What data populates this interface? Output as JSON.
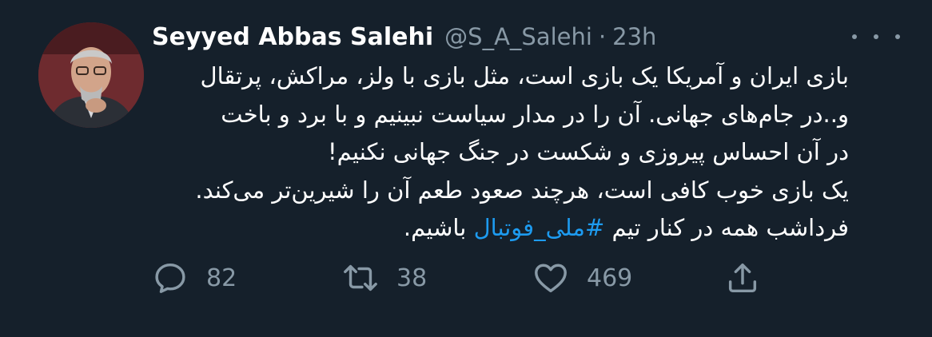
{
  "tweet": {
    "author_name": "Seyyed Abbas Salehi",
    "handle": "@S_A_Salehi",
    "separator": "·",
    "time": "23h",
    "body_lines": [
      "بازی ایران و آمریکا یک بازی است، مثل بازی با ولز، مراکش، پرتقال",
      "و..در جام‌های جهانی. آن را در مدار سیاست نبینیم و با برد و باخت",
      "در آن احساس پیروزی و شکست در جنگ جهانی نکنیم!",
      "یک بازی خوب کافی است، هرچند صعود طعم آن را شیرین‌تر می‌کند."
    ],
    "last_line": {
      "prefix": "فرداشب همه در کنار تیم ",
      "hashtag": "#ملی_فوتبال",
      "suffix": " باشیم."
    }
  },
  "actions": {
    "replies": "82",
    "retweets": "38",
    "likes": "469"
  },
  "colors": {
    "background": "#15202b",
    "text": "#ffffff",
    "secondary": "#8899a6",
    "link": "#1d9bf0"
  },
  "icons": [
    "more-icon",
    "reply-icon",
    "retweet-icon",
    "like-icon",
    "share-icon"
  ]
}
